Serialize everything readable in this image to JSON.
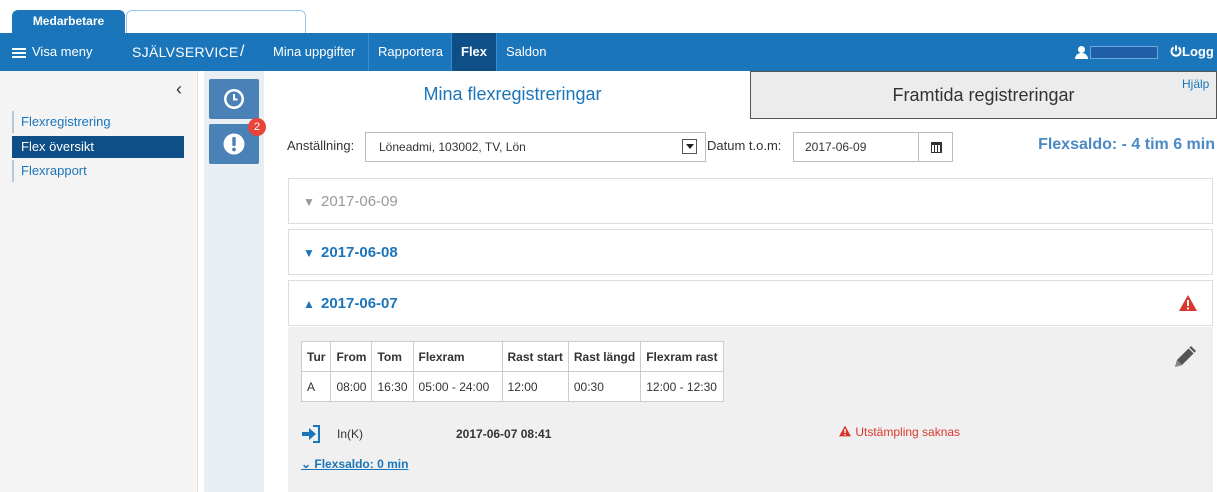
{
  "tabs": {
    "active_label": "Medarbetare"
  },
  "nav": {
    "menu_label": "Visa meny",
    "brand": "SJÄLVSERVICE",
    "slash": "/",
    "links": [
      "Mina uppgifter",
      "Rapportera",
      "Flex",
      "Saldon"
    ],
    "active_link": "Flex",
    "logout_label": "Logg"
  },
  "sidebar": {
    "collapse_glyph": "‹",
    "items": [
      {
        "label": "Flexregistrering",
        "active": false
      },
      {
        "label": "Flex översikt",
        "active": true
      },
      {
        "label": "Flexrapport",
        "active": false
      }
    ]
  },
  "rail": {
    "buttons": [
      "clock-icon",
      "alert-icon"
    ],
    "badge_count": "2"
  },
  "main": {
    "tab_mine": "Mina flexregistreringar",
    "tab_future": "Framtida registreringar",
    "help": "Hjälp",
    "employment_label": "Anställning:",
    "employment_value": "Löneadmi, 103002, TV, Lön",
    "date_label": "Datum t.o.m:",
    "date_value": "2017-06-09",
    "saldo": "Flexsaldo: - 4 tim 6 min",
    "days": [
      {
        "date": "2017-06-09",
        "expanded": false,
        "dim": true
      },
      {
        "date": "2017-06-08",
        "expanded": false,
        "dim": false
      },
      {
        "date": "2017-06-07",
        "expanded": true,
        "dim": false,
        "warning": true
      }
    ],
    "schedule_headers": [
      "Tur",
      "From",
      "Tom",
      "Flexram",
      "Rast start",
      "Rast längd",
      "Flexram rast"
    ],
    "schedule_rows": [
      [
        "A",
        "08:00",
        "16:30",
        "05:00 - 24:00",
        "12:00",
        "00:30",
        "12:00 - 12:30"
      ]
    ],
    "punch": {
      "type": "In(K)",
      "timestamp": "2017-06-07 08:41",
      "warning": "Utstämpling saknas"
    },
    "flexsaldo_link": "Flexsaldo: 0 min"
  },
  "colors": {
    "primary": "#1b75bb",
    "active_nav": "#0d4f86",
    "warning": "#d9372e",
    "badge": "#e8443a"
  }
}
